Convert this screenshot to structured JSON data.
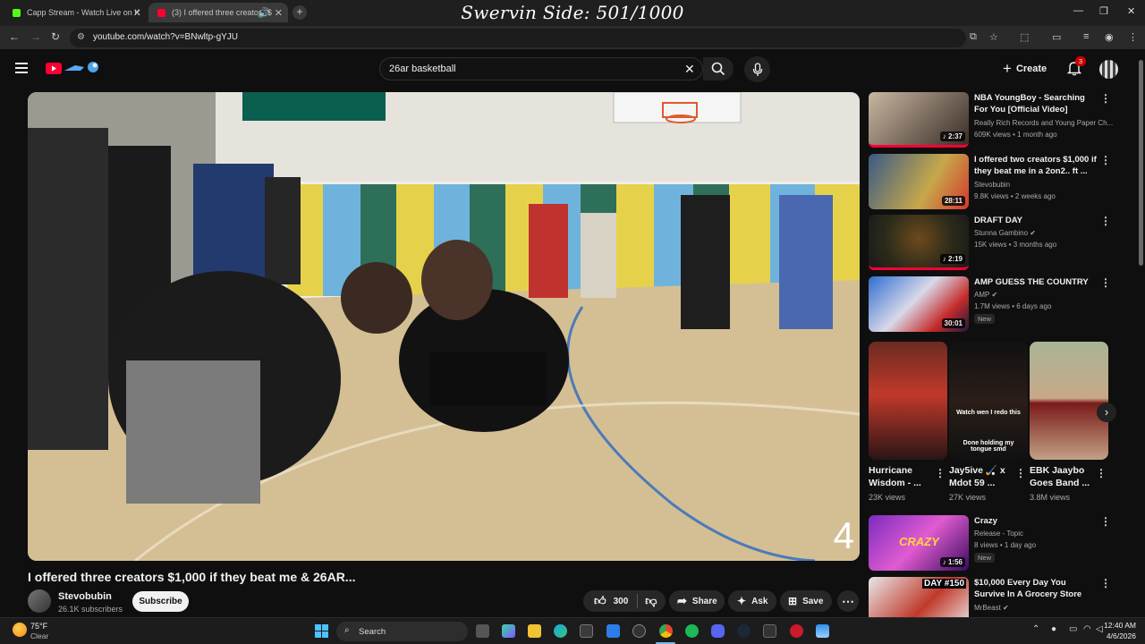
{
  "browser": {
    "tabs": [
      {
        "title": "Capp Stream - Watch Live on K",
        "favicon_color": "#53fc18"
      },
      {
        "title": "(3) I offered three creators $",
        "favicon_color": "#ff0033"
      }
    ],
    "overlay_text": "Swervin Side: 501/1000",
    "url": "youtube.com/watch?v=BNwltp-gYJU"
  },
  "header": {
    "search_value": "26ar basketball",
    "create_label": "Create",
    "notification_count": "3"
  },
  "video": {
    "title": "I offered three creators $1,000 if they beat me & 26AR...",
    "overlay_number": "4",
    "channel": "Stevobubin",
    "subscribers": "26.1K subscribers",
    "subscribe_label": "Subscribe",
    "likes": "300",
    "share_label": "Share",
    "ask_label": "Ask",
    "save_label": "Save"
  },
  "recommendations": [
    {
      "title": "NBA YoungBoy - Searching For You [Official Video]",
      "channel": "Really Rich Records and Young Paper Ch...",
      "meta": "609K views • 1 month ago",
      "duration": "2:37",
      "new": ""
    },
    {
      "title": "I offered two creators $1,000 if they beat me in a 2on2.. ft ...",
      "channel": "Stevobubin",
      "meta": "9.8K views • 2 weeks ago",
      "duration": "28:11",
      "new": ""
    },
    {
      "title": "DRAFT DAY",
      "channel": "Stunna Gambino",
      "meta": "15K views • 3 months ago",
      "duration": "2:19",
      "new": ""
    },
    {
      "title": "AMP GUESS THE COUNTRY",
      "channel": "AMP",
      "meta": "1.7M views • 6 days ago",
      "duration": "30:01",
      "new": "New"
    },
    {
      "title": "Crazy",
      "channel": "Release - Topic",
      "meta": "8 views • 1 day ago",
      "duration": "1:56",
      "new": "New"
    },
    {
      "title": "$10,000 Every Day You Survive In A Grocery Store",
      "channel": "MrBeast",
      "meta": "",
      "duration": "",
      "new": ""
    }
  ],
  "shorts": [
    {
      "title": "Hurricane Wisdom - ...",
      "views": "23K views",
      "caption": ""
    },
    {
      "title": "Jay5ive 🏑 x Mdot 59 ...",
      "views": "27K views",
      "caption": "Watch wen I redo this",
      "caption2": "Done holding my tongue smd"
    },
    {
      "title": "EBK Jaaybo Goes Band ...",
      "views": "3.8M views",
      "caption": ""
    }
  ],
  "thumb_texts": {
    "crazy": "CRAZY",
    "dayprefix": "DAY #150"
  },
  "taskbar": {
    "weather_temp": "75°F",
    "weather_desc": "Clear",
    "search_label": "Search",
    "time": "12:40 AM",
    "date": "4/6/2026"
  }
}
